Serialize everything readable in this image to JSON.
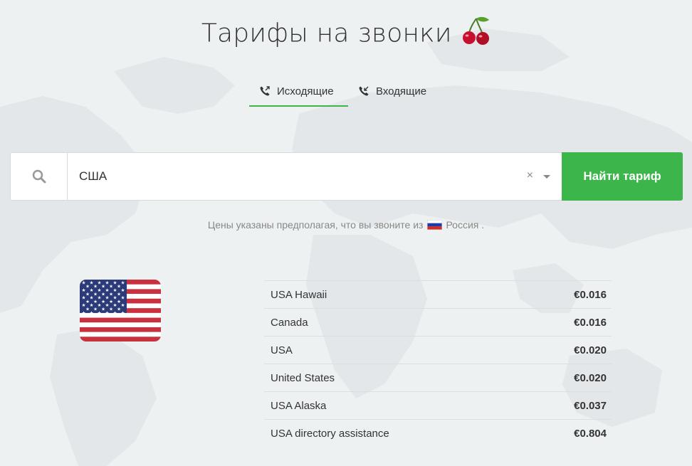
{
  "header": {
    "title": "Тарифы на звонки"
  },
  "tabs": [
    {
      "label": "Исходящие",
      "active": true,
      "icon": "outgoing-call-icon"
    },
    {
      "label": "Входящие",
      "active": false,
      "icon": "incoming-call-icon"
    }
  ],
  "search": {
    "value": "США",
    "clear_glyph": "×",
    "button_label": "Найти тариф"
  },
  "notice": {
    "text_before": "Цены указаны предполагая, что вы звоните из",
    "country": "Россия",
    "text_after": "."
  },
  "rates": [
    {
      "destination": "USA Hawaii",
      "price": "€0.016"
    },
    {
      "destination": "Canada",
      "price": "€0.016"
    },
    {
      "destination": "USA",
      "price": "€0.020"
    },
    {
      "destination": "United States",
      "price": "€0.020"
    },
    {
      "destination": "USA Alaska",
      "price": "€0.037"
    },
    {
      "destination": "USA directory assistance",
      "price": "€0.804"
    }
  ],
  "colors": {
    "accent": "#3cb54a",
    "background": "#eef1f2",
    "text": "#333333",
    "muted": "#888888"
  }
}
